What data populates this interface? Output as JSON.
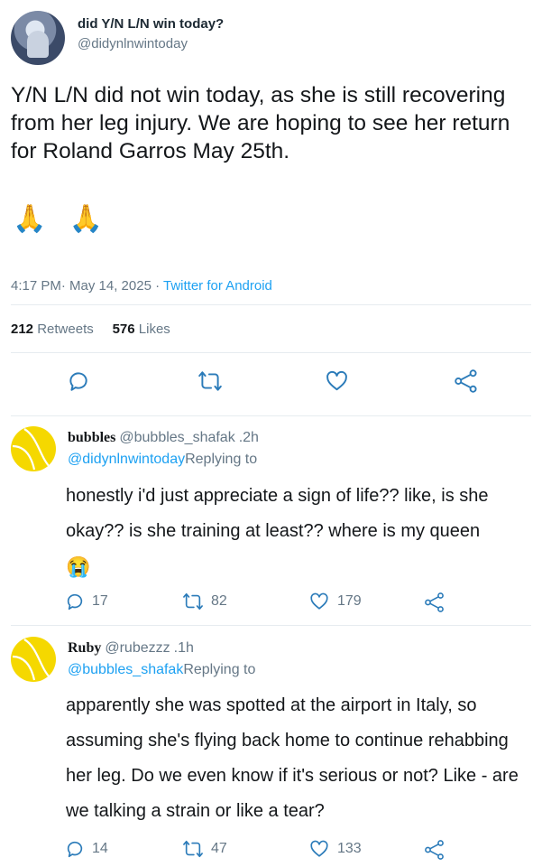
{
  "tweet": {
    "display_name": "did Y/N L/N win today?",
    "handle": "@didynlnwintoday",
    "text": "Y/N L/N did not win today, as she is still recovering from her leg injury. We are hoping to see her return for Roland Garros May 25th.",
    "emoji": "🙏 🙏",
    "timestamp": "4:17 PM· May 14, 2025 ·",
    "source": "Twitter for Android",
    "retweets_count": "212",
    "retweets_label": "Retweets",
    "likes_count": "576",
    "likes_label": "Likes"
  },
  "actions": {
    "icons": [
      "reply-icon",
      "retweet-icon",
      "like-icon",
      "share-icon"
    ]
  },
  "replies": [
    {
      "name": "bubbles",
      "handle": "@bubbles_shafak",
      "time": ".2h",
      "reply_to_handle": "@didynlnwintoday",
      "replying_label": "Replying to",
      "text": "honestly i'd just appreciate a sign of life?? like, is she okay?? is she training at least?? where is my queen",
      "emoji": "😭",
      "reply_count": "17",
      "retweet_count": "82",
      "like_count": "179"
    },
    {
      "name": "Ruby",
      "handle": "@rubezzz",
      "time": ".1h",
      "reply_to_handle": "@bubbles_shafak",
      "replying_label": "Replying to",
      "text": "apparently she was spotted at the airport in Italy, so assuming she's flying back home to continue rehabbing her leg. Do we even know if it's serious or not? Like - are we talking a strain or like a tear?",
      "reply_count": "14",
      "retweet_count": "47",
      "like_count": "133"
    }
  ],
  "colors": {
    "accent": "#1da1f2",
    "muted": "#657786",
    "avatar_yellow": "#f5d800"
  }
}
